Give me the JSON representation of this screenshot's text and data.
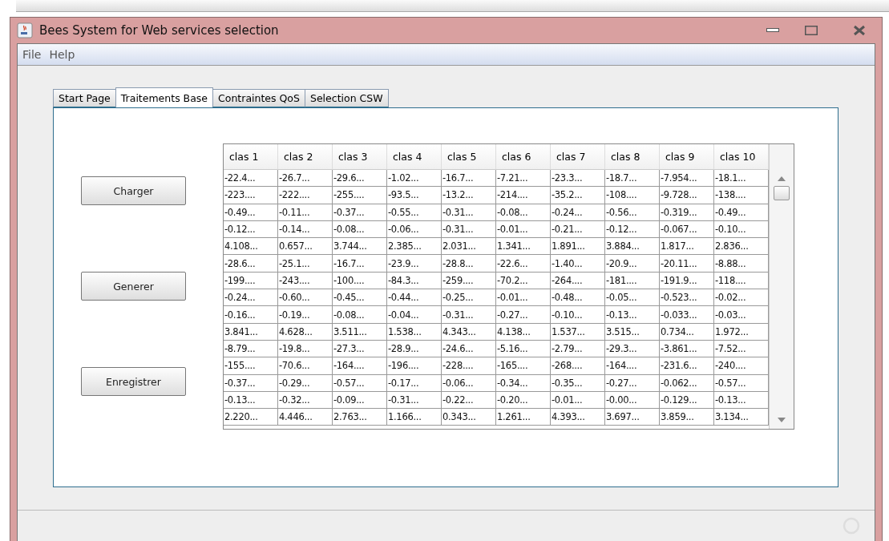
{
  "window": {
    "title": "Bees System for Web services selection"
  },
  "menu": [
    "File",
    "Help"
  ],
  "tabs": [
    {
      "label": "Start Page",
      "selected": false
    },
    {
      "label": "Traitements Base",
      "selected": true
    },
    {
      "label": "Contraintes QoS",
      "selected": false
    },
    {
      "label": "Selection CSW",
      "selected": false
    }
  ],
  "buttons": [
    "Charger",
    "Generer",
    "Enregistrer"
  ],
  "table": {
    "columns": [
      "clas 1",
      "clas 2",
      "clas 3",
      "clas 4",
      "clas 5",
      "clas 6",
      "clas 7",
      "clas 8",
      "clas 9",
      "clas 10"
    ],
    "rows": [
      [
        "-22.4...",
        "-26.7...",
        "-29.6...",
        "-1.02...",
        "-16.7...",
        "-7.21...",
        "-23.3...",
        "-18.7...",
        "-7.954...",
        "-18.1..."
      ],
      [
        "-223....",
        "-222....",
        "-255....",
        "-93.5...",
        "-13.2...",
        "-214....",
        "-35.2...",
        "-108....",
        "-9.728...",
        "-138...."
      ],
      [
        "-0.49...",
        "-0.11...",
        "-0.37...",
        "-0.55...",
        "-0.31...",
        "-0.08...",
        "-0.24...",
        "-0.56...",
        "-0.319...",
        "-0.49..."
      ],
      [
        "-0.12...",
        "-0.14...",
        "-0.08...",
        "-0.06...",
        "-0.31...",
        "-0.01...",
        "-0.21...",
        "-0.12...",
        "-0.067...",
        "-0.10..."
      ],
      [
        "4.108...",
        "0.657...",
        "3.744...",
        "2.385...",
        "2.031...",
        "1.341...",
        "1.891...",
        "3.884...",
        "1.817...",
        "2.836..."
      ],
      [
        "-28.6...",
        "-25.1...",
        "-16.7...",
        "-23.9...",
        "-28.8...",
        "-22.6...",
        "-1.40...",
        "-20.9...",
        "-20.11...",
        "-8.88..."
      ],
      [
        "-199....",
        "-243....",
        "-100....",
        "-84.3...",
        "-259....",
        "-70.2...",
        "-264....",
        "-181....",
        "-191.9...",
        "-118...."
      ],
      [
        "-0.24...",
        "-0.60...",
        "-0.45...",
        "-0.44...",
        "-0.25...",
        "-0.01...",
        "-0.48...",
        "-0.05...",
        "-0.523...",
        "-0.02..."
      ],
      [
        "-0.16...",
        "-0.19...",
        "-0.08...",
        "-0.04...",
        "-0.31...",
        "-0.27...",
        "-0.10...",
        "-0.13...",
        "-0.033...",
        "-0.03..."
      ],
      [
        "3.841...",
        "4.628...",
        "3.511...",
        "1.538...",
        "4.343...",
        "4.138...",
        "1.537...",
        "3.515...",
        "0.734...",
        "1.972..."
      ],
      [
        "-8.79...",
        "-19.8...",
        "-27.3...",
        "-28.9...",
        "-24.6...",
        "-5.16...",
        "-2.79...",
        "-29.3...",
        "-3.861...",
        "-7.52..."
      ],
      [
        "-155....",
        "-70.6...",
        "-164....",
        "-196....",
        "-228....",
        "-165....",
        "-268....",
        "-164....",
        "-231.6...",
        "-240...."
      ],
      [
        "-0.37...",
        "-0.29...",
        "-0.57...",
        "-0.17...",
        "-0.06...",
        "-0.34...",
        "-0.35...",
        "-0.27...",
        "-0.062...",
        "-0.57..."
      ],
      [
        "-0.13...",
        "-0.32...",
        "-0.09...",
        "-0.31...",
        "-0.22...",
        "-0.20...",
        "-0.01...",
        "-0.00...",
        "-0.129...",
        "-0.13..."
      ],
      [
        "2.220...",
        "4.446...",
        "2.763...",
        "1.166...",
        "0.343...",
        "1.261...",
        "4.393...",
        "3.697...",
        "3.859...",
        "3.134..."
      ]
    ]
  }
}
